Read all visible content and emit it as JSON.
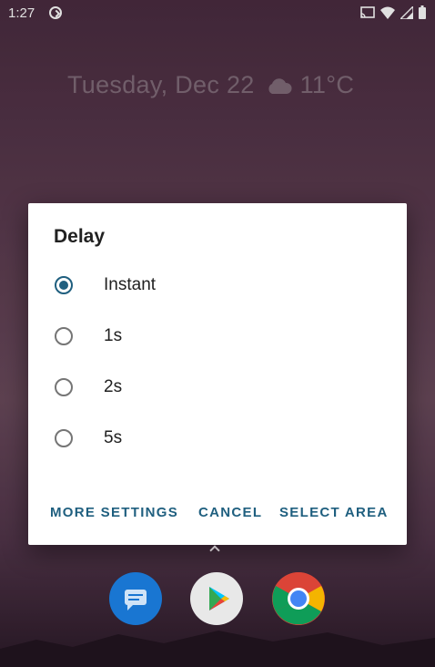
{
  "status_bar": {
    "time": "1:27",
    "icons": [
      "cast-icon",
      "wifi-icon",
      "signal-icon",
      "battery-icon"
    ]
  },
  "home": {
    "date": "Tuesday, Dec 22",
    "weather_temp": "11°C",
    "weather_icon": "cloud-icon"
  },
  "dialog": {
    "title": "Delay",
    "options": [
      {
        "label": "Instant",
        "selected": true
      },
      {
        "label": "1s",
        "selected": false
      },
      {
        "label": "2s",
        "selected": false
      },
      {
        "label": "5s",
        "selected": false
      }
    ],
    "actions": {
      "more_settings": "MORE SETTINGS",
      "cancel": "CANCEL",
      "select_area": "SELECT AREA"
    }
  },
  "dock": {
    "apps": [
      "messages-app-icon",
      "play-store-app-icon",
      "chrome-app-icon"
    ]
  },
  "colors": {
    "accent": "#1f5f7f",
    "text": "#212121",
    "radio_unchecked": "#757575"
  }
}
